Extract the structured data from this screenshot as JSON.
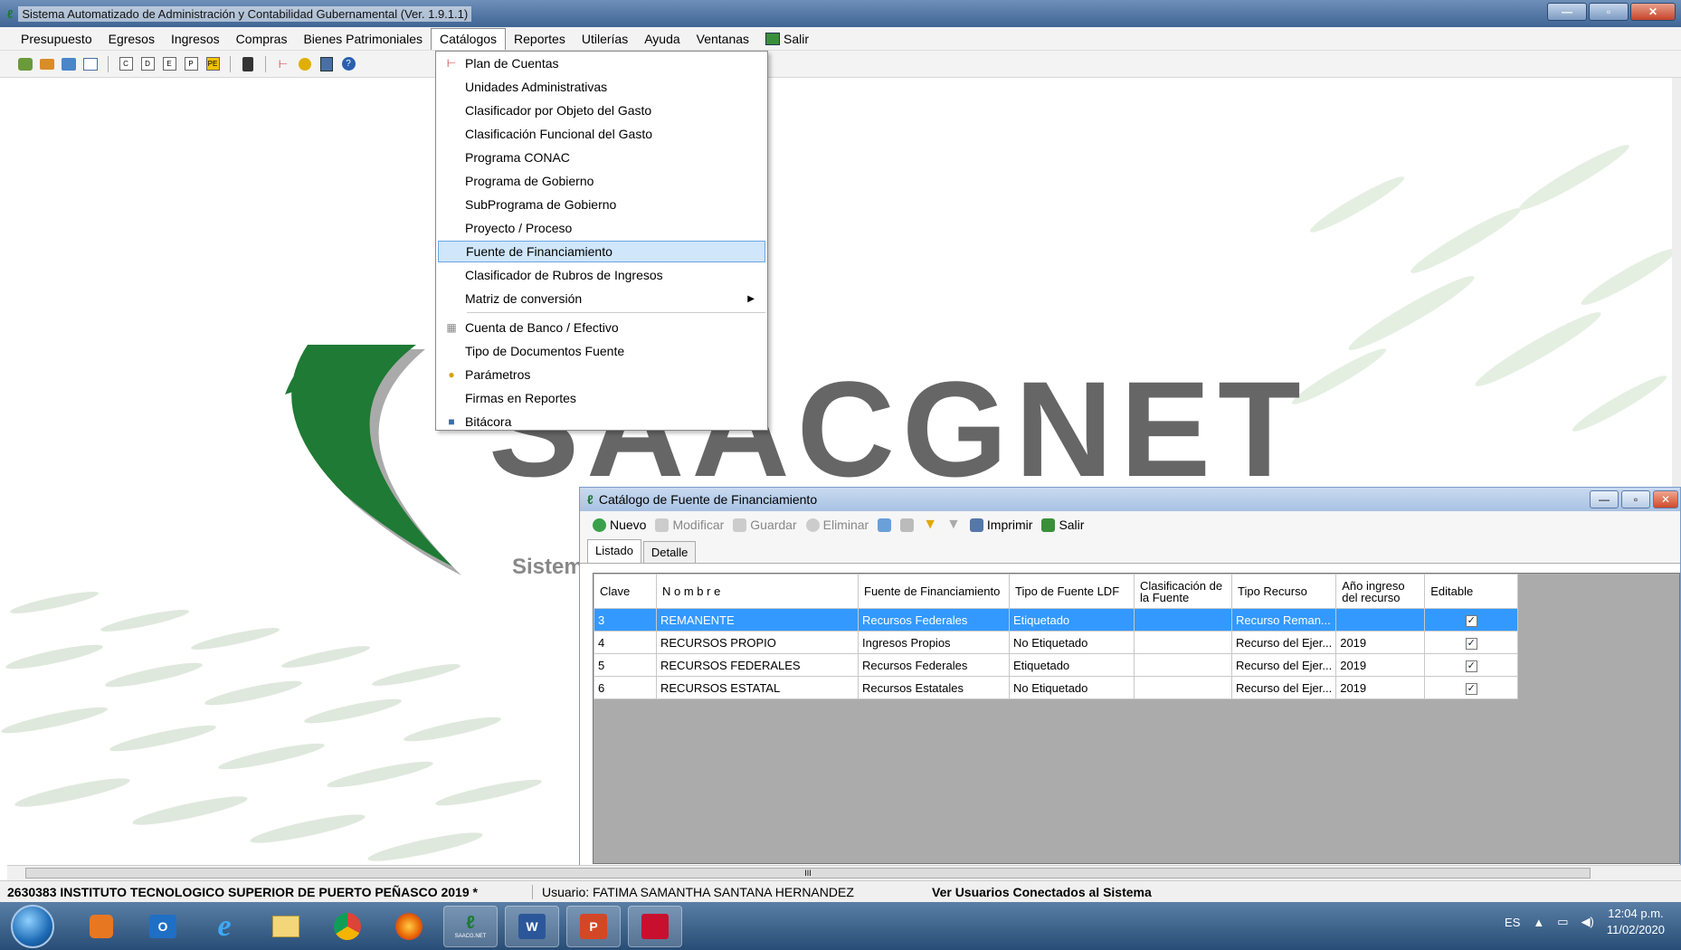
{
  "window": {
    "title": "Sistema Automatizado de Administración y Contabilidad Gubernamental  (Ver. 1.9.1.1)"
  },
  "menubar": {
    "items": [
      "Presupuesto",
      "Egresos",
      "Ingresos",
      "Compras",
      "Bienes Patrimoniales",
      "Catálogos",
      "Reportes",
      "Utilerías",
      "Ayuda",
      "Ventanas",
      "Salir"
    ]
  },
  "toolbar": {
    "icons": [
      "users-icon",
      "transfer-icon",
      "check-icon",
      "calendar-icon",
      "c-icon",
      "d-icon",
      "e-icon",
      "p-icon",
      "pe-icon",
      "clipboard-icon",
      "tree-icon",
      "settings-icon",
      "save-icon",
      "help-icon"
    ],
    "letters": [
      "C",
      "D",
      "E",
      "P",
      "PE"
    ]
  },
  "dropdown": {
    "items": [
      "Plan de Cuentas",
      "Unidades Administrativas",
      "Clasificador por Objeto del Gasto",
      "Clasificación Funcional del Gasto",
      "Programa CONAC",
      "Programa de Gobierno",
      "SubPrograma de Gobierno",
      "Proyecto / Proceso",
      "Fuente de Financiamiento",
      "Clasificador de Rubros de Ingresos",
      "Matriz de conversión",
      "Cuenta de Banco / Efectivo",
      "Tipo de Documentos Fuente",
      "Parámetros",
      "Firmas en Reportes",
      "Bitácora"
    ]
  },
  "logo": {
    "text": "SAACGNET",
    "subtitle": "Sistem"
  },
  "catalog": {
    "title": "Catálogo de Fuente de Financiamiento",
    "toolbar": {
      "nuevo": "Nuevo",
      "modificar": "Modificar",
      "guardar": "Guardar",
      "eliminar": "Eliminar",
      "imprimir": "Imprimir",
      "salir": "Salir"
    },
    "tabs": [
      "Listado",
      "Detalle"
    ],
    "columns": [
      "Clave",
      "N o m b r e",
      "Fuente de Financiamiento",
      "Tipo de Fuente LDF",
      "Clasificación de la Fuente",
      "Tipo Recurso",
      "Año ingreso del recurso",
      "Editable"
    ],
    "rows": [
      [
        "3",
        "REMANENTE",
        "Recursos Federales",
        "Etiquetado",
        "",
        "Recurso Reman...",
        "",
        "✓"
      ],
      [
        "4",
        "RECURSOS PROPIO",
        "Ingresos Propios",
        "No Etiquetado",
        "",
        "Recurso del Ejer...",
        "2019",
        "✓"
      ],
      [
        "5",
        "RECURSOS FEDERALES",
        "Recursos Federales",
        "Etiquetado",
        "",
        "Recurso del Ejer...",
        "2019",
        "✓"
      ],
      [
        "6",
        "RECURSOS ESTATAL",
        "Recursos Estatales",
        "No Etiquetado",
        "",
        "Recurso del Ejer...",
        "2019",
        "✓"
      ]
    ]
  },
  "statusbar": {
    "entity": "2630383 INSTITUTO TECNOLOGICO SUPERIOR DE PUERTO PEÑASCO  2019  *",
    "user": "Usuario: FATIMA SAMANTHA SANTANA HERNANDEZ",
    "connected": "Ver Usuarios Conectados al Sistema"
  },
  "taskbar": {
    "lang": "ES",
    "time": "12:04 p.m.",
    "date": "11/02/2020",
    "saacgnet_label": "SAACG.NET",
    "outlook_label": "O",
    "word_label": "W",
    "ppt_label": "P"
  },
  "scroll": {
    "grip": "III"
  }
}
